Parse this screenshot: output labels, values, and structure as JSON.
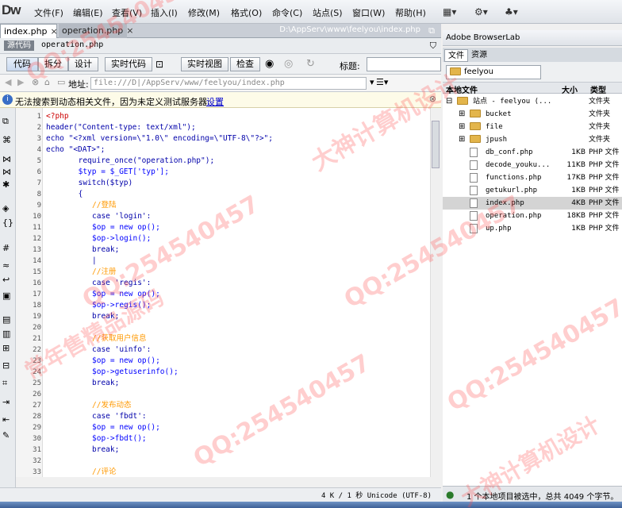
{
  "menubar": {
    "logo": "Dw",
    "items": [
      "文件(F)",
      "编辑(E)",
      "查看(V)",
      "插入(I)",
      "修改(M)",
      "格式(O)",
      "命令(C)",
      "站点(S)",
      "窗口(W)",
      "帮助(H)"
    ]
  },
  "tabs": [
    {
      "label": "index.php",
      "active": true
    },
    {
      "label": "operation.php",
      "active": false
    }
  ],
  "file_path": "D:\\AppServ\\www\\feelyou\\index.php",
  "related": {
    "badge": "源代码",
    "file": "operation.php"
  },
  "doc_toolbar": {
    "code": "代码",
    "split": "拆分",
    "design": "设计",
    "live_code": "实时代码",
    "live_view": "实时视图",
    "inspect": "检查",
    "title_label": "标题:"
  },
  "address": {
    "label": "地址:",
    "value": "file:///D|/AppServ/www/feelyou/index.php"
  },
  "info_bar": {
    "message": "无法搜索到动态相关文件，因为未定义测试服务器:",
    "link": "设置"
  },
  "code_lines": [
    {
      "n": "1",
      "t": "<?php",
      "c": "php",
      "i": 0
    },
    {
      "n": "2",
      "t": "header(\"Content-type: text/xml\");",
      "c": "plain",
      "i": 0
    },
    {
      "n": "3",
      "t": "echo \"<?xml version=\\\"1.0\\\" encoding=\\\"UTF-8\\\"?>\";",
      "c": "plain",
      "i": 0
    },
    {
      "n": "4",
      "t": "echo \"<DAT>\";",
      "c": "plain",
      "i": 0
    },
    {
      "n": "5",
      "t": "require_once(\"operation.php\");",
      "c": "plain",
      "i": 7
    },
    {
      "n": "6",
      "t": "$typ = $_GET['typ'];",
      "c": "var",
      "i": 7
    },
    {
      "n": "7",
      "t": "switch($typ)",
      "c": "plain",
      "i": 7
    },
    {
      "n": "8",
      "t": "{",
      "c": "plain",
      "i": 7
    },
    {
      "n": "9",
      "t": "//登陆",
      "c": "cmt",
      "i": 10
    },
    {
      "n": "10",
      "t": "case 'login':",
      "c": "plain",
      "i": 10
    },
    {
      "n": "11",
      "t": "$op = new op();",
      "c": "var",
      "i": 10
    },
    {
      "n": "12",
      "t": "$op->login();",
      "c": "var",
      "i": 10
    },
    {
      "n": "13",
      "t": "break;",
      "c": "plain",
      "i": 10
    },
    {
      "n": "14",
      "t": "|",
      "c": "plain",
      "i": 10
    },
    {
      "n": "15",
      "t": "//注册",
      "c": "cmt",
      "i": 10
    },
    {
      "n": "16",
      "t": "case 'regis':",
      "c": "plain",
      "i": 10
    },
    {
      "n": "17",
      "t": "$op = new op();",
      "c": "var",
      "i": 10
    },
    {
      "n": "18",
      "t": "$op->regis();",
      "c": "var",
      "i": 10
    },
    {
      "n": "19",
      "t": "break;",
      "c": "plain",
      "i": 10
    },
    {
      "n": "20",
      "t": "",
      "c": "plain",
      "i": 10
    },
    {
      "n": "21",
      "t": "//获取用户信息",
      "c": "cmt",
      "i": 10
    },
    {
      "n": "22",
      "t": "case 'uinfo':",
      "c": "plain",
      "i": 10
    },
    {
      "n": "23",
      "t": "$op = new op();",
      "c": "var",
      "i": 10
    },
    {
      "n": "24",
      "t": "$op->getuserinfo();",
      "c": "var",
      "i": 10
    },
    {
      "n": "25",
      "t": "break;",
      "c": "plain",
      "i": 10
    },
    {
      "n": "26",
      "t": "",
      "c": "plain",
      "i": 10
    },
    {
      "n": "27",
      "t": "//发布动态",
      "c": "cmt",
      "i": 10
    },
    {
      "n": "28",
      "t": "case 'fbdt':",
      "c": "plain",
      "i": 10
    },
    {
      "n": "29",
      "t": "$op = new op();",
      "c": "var",
      "i": 10
    },
    {
      "n": "30",
      "t": "$op->fbdt();",
      "c": "var",
      "i": 10
    },
    {
      "n": "31",
      "t": "break;",
      "c": "plain",
      "i": 10
    },
    {
      "n": "32",
      "t": "",
      "c": "plain",
      "i": 10
    },
    {
      "n": "33",
      "t": "//评论",
      "c": "cmt",
      "i": 10
    }
  ],
  "status": {
    "text": "4 K / 1 秒  Unicode (UTF-8)"
  },
  "right_panel": {
    "title": "Adobe BrowserLab",
    "tabs": [
      "文件",
      "资源"
    ],
    "site": "feelyou",
    "headers": {
      "name": "本地文件",
      "size": "大小",
      "type": "类型"
    },
    "rows": [
      {
        "name": "站点 - feelyou (...",
        "size": "",
        "type": "文件夹",
        "kind": "site",
        "level": 0,
        "expand": "⊟"
      },
      {
        "name": "bucket",
        "size": "",
        "type": "文件夹",
        "kind": "folder",
        "level": 1,
        "expand": "⊞"
      },
      {
        "name": "file",
        "size": "",
        "type": "文件夹",
        "kind": "folder",
        "level": 1,
        "expand": "⊞"
      },
      {
        "name": "jpush",
        "size": "",
        "type": "文件夹",
        "kind": "folder",
        "level": 1,
        "expand": "⊞"
      },
      {
        "name": "db_conf.php",
        "size": "1KB",
        "type": "PHP 文件",
        "kind": "file",
        "level": 1,
        "expand": ""
      },
      {
        "name": "decode_youku...",
        "size": "11KB",
        "type": "PHP 文件",
        "kind": "file",
        "level": 1,
        "expand": ""
      },
      {
        "name": "functions.php",
        "size": "17KB",
        "type": "PHP 文件",
        "kind": "file",
        "level": 1,
        "expand": ""
      },
      {
        "name": "getukurl.php",
        "size": "1KB",
        "type": "PHP 文件",
        "kind": "file",
        "level": 1,
        "expand": ""
      },
      {
        "name": "index.php",
        "size": "4KB",
        "type": "PHP 文件",
        "kind": "file",
        "level": 1,
        "expand": "",
        "selected": true
      },
      {
        "name": "operation.php",
        "size": "18KB",
        "type": "PHP 文件",
        "kind": "file",
        "level": 1,
        "expand": ""
      },
      {
        "name": "up.php",
        "size": "1KB",
        "type": "PHP 文件",
        "kind": "file",
        "level": 1,
        "expand": ""
      }
    ],
    "status": "1 个本地项目被选中，总共 4049 个字节。"
  },
  "watermarks": {
    "qq": "QQ:254540457",
    "dashen": "大神计算机设计",
    "changnian": "常年售精品源码"
  }
}
